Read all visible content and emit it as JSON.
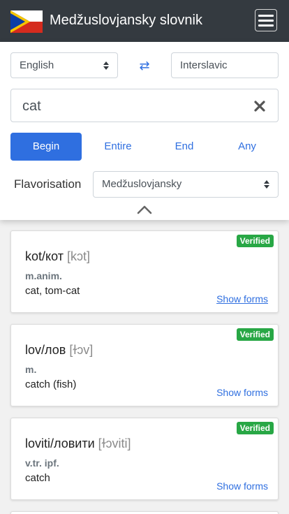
{
  "header": {
    "title": "Medžuslovjansky slovnik"
  },
  "languages": {
    "source": "English",
    "swap_icon": "⇄",
    "target": "Interslavic"
  },
  "search": {
    "value": "cat"
  },
  "modes": [
    "Begin",
    "Entire",
    "End",
    "Any"
  ],
  "flavorisation": {
    "label": "Flavorisation",
    "selected": "Medžuslovjansky"
  },
  "results": [
    {
      "word": "kot/кот",
      "ipa": "[kɔt]",
      "pos": "m.anim.",
      "translation": "cat, tom-cat",
      "badge": "Verified",
      "forms": "Show forms"
    },
    {
      "word": "lov/лов",
      "ipa": "[ɫɔv]",
      "pos": "m.",
      "translation": "catch (fish)",
      "badge": "Verified",
      "forms": "Show forms"
    },
    {
      "word": "loviti/ловити",
      "ipa": "[ɫɔviti]",
      "pos": "v.tr. ipf.",
      "translation": "catch",
      "badge": "Verified",
      "forms": "Show forms"
    }
  ],
  "colors": {
    "navbar": "#343a40",
    "accent": "#2f6fe0",
    "verified": "#28a745"
  }
}
